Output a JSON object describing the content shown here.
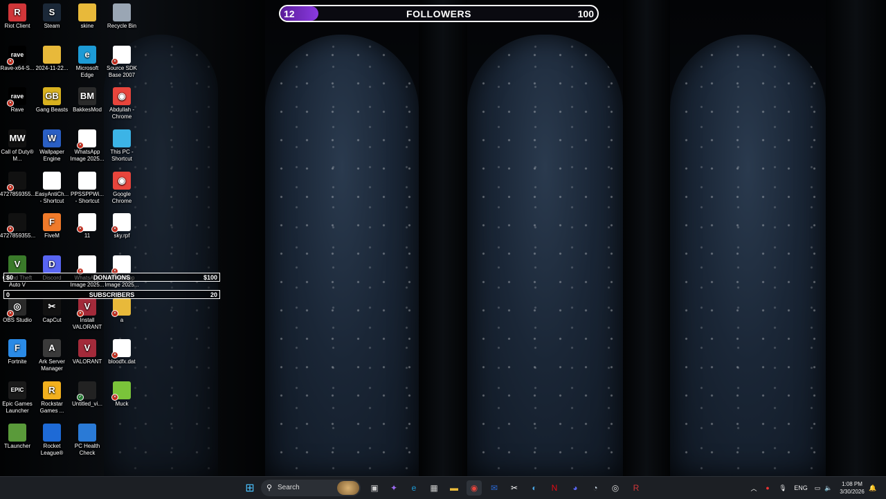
{
  "desktop": {
    "icons": [
      {
        "label": "Riot Client",
        "glyph": "R",
        "color": "#d13639",
        "badge": ""
      },
      {
        "label": "Steam",
        "glyph": "S",
        "color": "#1b2838",
        "badge": ""
      },
      {
        "label": "skine",
        "glyph": "",
        "color": "#e8b93a",
        "badge": ""
      },
      {
        "label": "Recycle Bin",
        "glyph": "",
        "color": "#9aa6b4",
        "badge": ""
      },
      {
        "label": "Rave-x64-S...",
        "glyph": "rave",
        "color": "#000000",
        "badge": "x"
      },
      {
        "label": "2024-11-22...",
        "glyph": "",
        "color": "#e8b93a",
        "badge": ""
      },
      {
        "label": "Microsoft Edge",
        "glyph": "e",
        "color": "#1d9bd6",
        "badge": ""
      },
      {
        "label": "Source SDK Base 2007",
        "glyph": "",
        "color": "#ffffff",
        "badge": "x"
      },
      {
        "label": "Rave",
        "glyph": "rave",
        "color": "#000000",
        "badge": "x"
      },
      {
        "label": "Gang Beasts",
        "glyph": "GB",
        "color": "#d9b21f",
        "badge": ""
      },
      {
        "label": "BakkesMod",
        "glyph": "BM",
        "color": "#2a2a2a",
        "badge": ""
      },
      {
        "label": "Abdullah - Chrome",
        "glyph": "◉",
        "color": "#e8453c",
        "badge": ""
      },
      {
        "label": "Call of Duty® M...",
        "glyph": "MW",
        "color": "#111111",
        "badge": ""
      },
      {
        "label": "Wallpaper Engine",
        "glyph": "W",
        "color": "#2a5fc4",
        "badge": ""
      },
      {
        "label": "WhatsApp Image 2025...",
        "glyph": "",
        "color": "#ffffff",
        "badge": "x"
      },
      {
        "label": "This PC - Shortcut",
        "glyph": "",
        "color": "#3cb4e6",
        "badge": ""
      },
      {
        "label": "4727859355...",
        "glyph": "",
        "color": "#111111",
        "badge": "x"
      },
      {
        "label": "EasyAntiCh... - Shortcut",
        "glyph": "",
        "color": "#ffffff",
        "badge": ""
      },
      {
        "label": "PPSSPPWi... - Shortcut",
        "glyph": "",
        "color": "#ffffff",
        "badge": ""
      },
      {
        "label": "Google Chrome",
        "glyph": "◉",
        "color": "#e8453c",
        "badge": ""
      },
      {
        "label": "4727859355...",
        "glyph": "",
        "color": "#111111",
        "badge": "x"
      },
      {
        "label": "FiveM",
        "glyph": "F",
        "color": "#f07a2a",
        "badge": ""
      },
      {
        "label": "11",
        "glyph": "",
        "color": "#ffffff",
        "badge": "x"
      },
      {
        "label": "sky.rpf",
        "glyph": "",
        "color": "#ffffff",
        "badge": "x"
      },
      {
        "label": "Grand Theft Auto V",
        "glyph": "V",
        "color": "#3a7a2a",
        "badge": ""
      },
      {
        "label": "Discord",
        "glyph": "D",
        "color": "#5865f2",
        "badge": ""
      },
      {
        "label": "WhatsApp Image 2025...",
        "glyph": "",
        "color": "#ffffff",
        "badge": "x"
      },
      {
        "label": "WhatsApp Image 2025...",
        "glyph": "",
        "color": "#ffffff",
        "badge": "x"
      },
      {
        "label": "OBS Studio",
        "glyph": "◎",
        "color": "#2a2a2a",
        "badge": "x"
      },
      {
        "label": "CapCut",
        "glyph": "✂",
        "color": "#111111",
        "badge": ""
      },
      {
        "label": "Install VALORANT",
        "glyph": "V",
        "color": "#a32a3a",
        "badge": "x"
      },
      {
        "label": "a",
        "glyph": "",
        "color": "#e8b93a",
        "badge": "x"
      },
      {
        "label": "Fortnite",
        "glyph": "F",
        "color": "#2a8ae6",
        "badge": ""
      },
      {
        "label": "Ark Server Manager",
        "glyph": "A",
        "color": "#3a3a3a",
        "badge": ""
      },
      {
        "label": "VALORANT",
        "glyph": "V",
        "color": "#a32a3a",
        "badge": ""
      },
      {
        "label": "bloodfx.dat",
        "glyph": "",
        "color": "#ffffff",
        "badge": "x"
      },
      {
        "label": "Epic Games Launcher",
        "glyph": "EPIC",
        "color": "#1a1a1a",
        "badge": ""
      },
      {
        "label": "Rockstar Games ...",
        "glyph": "R",
        "color": "#f2b01e",
        "badge": ""
      },
      {
        "label": "Untitled_vi...",
        "glyph": "",
        "color": "#222222",
        "badge": "ok"
      },
      {
        "label": "Muck",
        "glyph": "",
        "color": "#7ac43a",
        "badge": "x"
      },
      {
        "label": "TLauncher",
        "glyph": "",
        "color": "#5a9a3a",
        "badge": ""
      },
      {
        "label": "Rocket League®",
        "glyph": "",
        "color": "#1e6ad6",
        "badge": ""
      },
      {
        "label": "PC Health Check",
        "glyph": "",
        "color": "#2a7ad6",
        "badge": ""
      }
    ]
  },
  "followers_goal": {
    "current": "12",
    "title": "FOLLOWERS",
    "target": "100",
    "progress": 0.12
  },
  "donations_bar": {
    "left": "$0",
    "title": "DONATIONS",
    "right": "$100"
  },
  "subscribers_bar": {
    "left": "0",
    "title": "SUBSCRIBERS",
    "right": "20"
  },
  "taskbar": {
    "search_label": "Search",
    "apps": [
      "windows-start-icon",
      "task-view-icon",
      "copilot-icon",
      "edge-icon",
      "store-icon",
      "file-explorer-icon",
      "chrome-icon",
      "outlook-icon",
      "capcut-icon",
      "steam-like-icon",
      "netflix-icon",
      "discord-icon",
      "steam-icon",
      "obs-icon",
      "riot-icon"
    ],
    "tray": {
      "lang": "ENG",
      "time": "1:08 PM",
      "date": "3/30/2026"
    }
  }
}
